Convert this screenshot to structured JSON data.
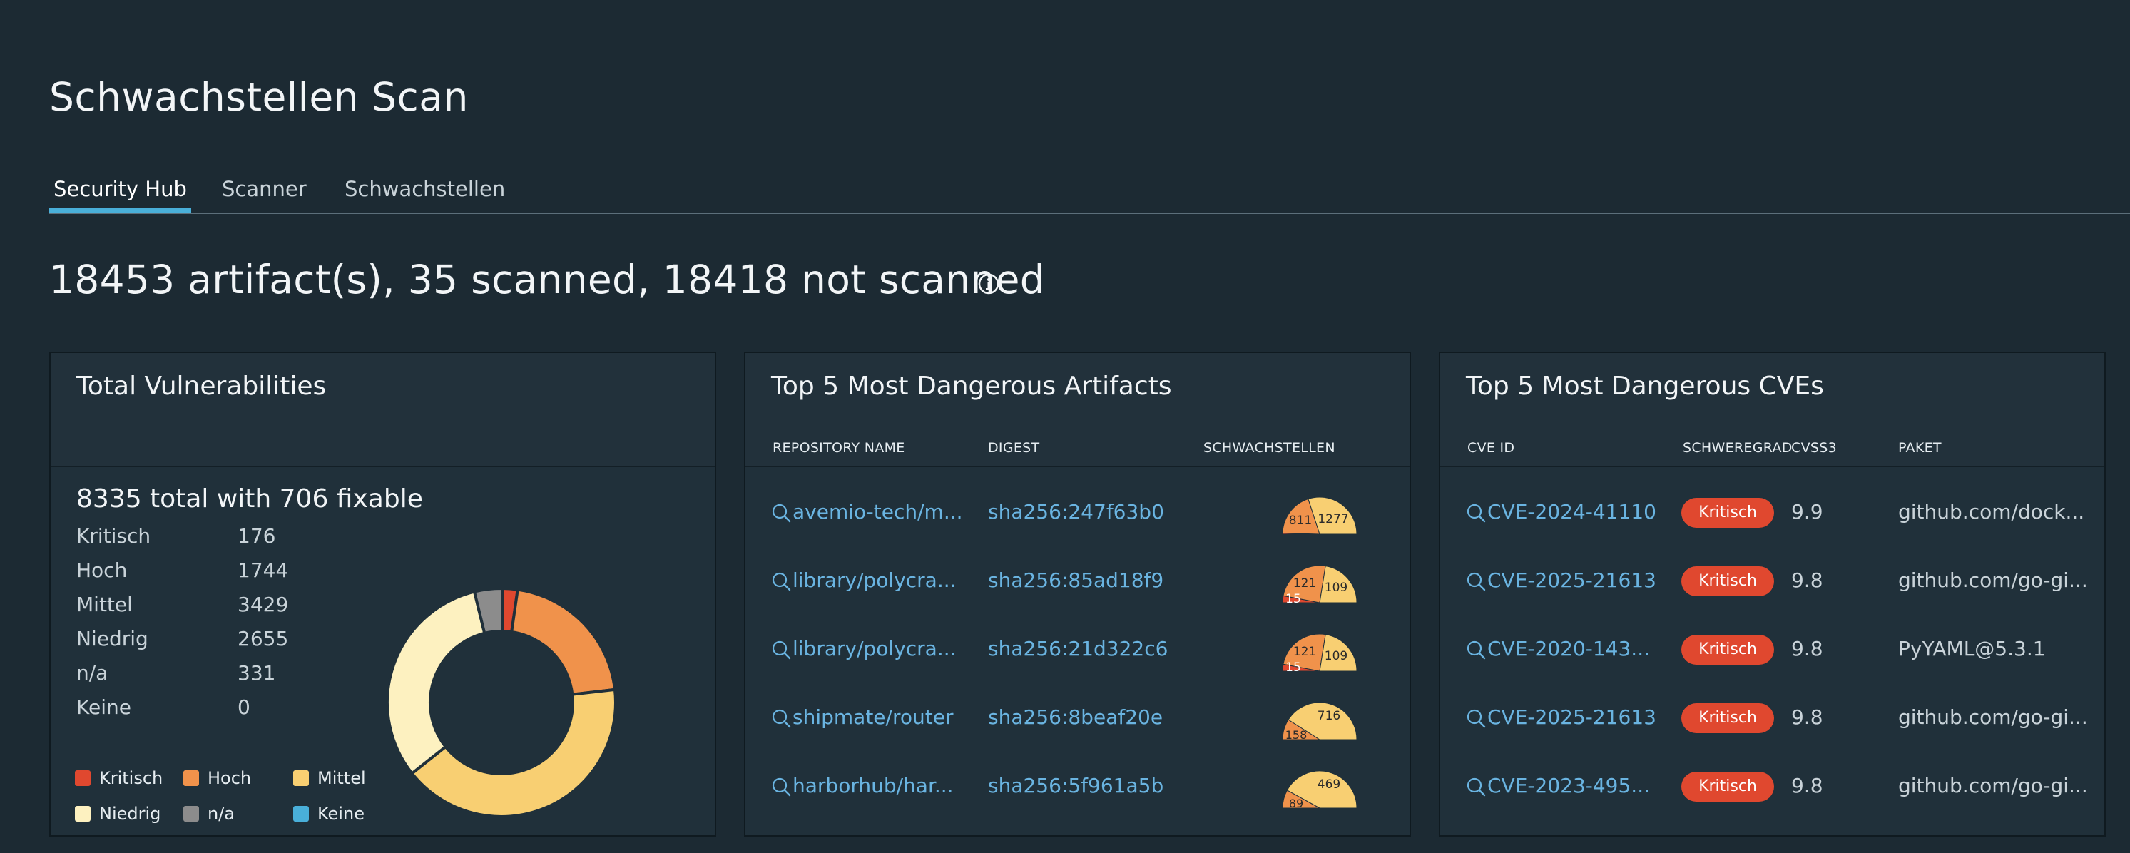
{
  "page": {
    "title": "Schwachstellen Scan"
  },
  "tabs": [
    {
      "label": "Security Hub",
      "active": true
    },
    {
      "label": "Scanner",
      "active": false
    },
    {
      "label": "Schwachstellen",
      "active": false
    }
  ],
  "summary": {
    "text": "18453 artifact(s), 35 scanned, 18418 not scanned",
    "icon": "info-icon"
  },
  "total_vulnerabilities": {
    "title": "Total Vulnerabilities",
    "headline": "8335 total with 706 fixable",
    "severities": [
      {
        "label": "Kritisch",
        "value": "176"
      },
      {
        "label": "Hoch",
        "value": "1744"
      },
      {
        "label": "Mittel",
        "value": "3429"
      },
      {
        "label": "Niedrig",
        "value": "2655"
      },
      {
        "label": "n/a",
        "value": "331"
      },
      {
        "label": "Keine",
        "value": "0"
      }
    ],
    "legend": [
      {
        "label": "Kritisch",
        "color": "#e0482f"
      },
      {
        "label": "Hoch",
        "color": "#f0924b"
      },
      {
        "label": "Mittel",
        "color": "#f8cf72"
      },
      {
        "label": "Niedrig",
        "color": "#fdf1c0"
      },
      {
        "label": "n/a",
        "color": "#8c8c8c"
      },
      {
        "label": "Keine",
        "color": "#49afd9"
      }
    ]
  },
  "chart_data": {
    "type": "pie",
    "categories": [
      "Kritisch",
      "Hoch",
      "Mittel",
      "Niedrig",
      "n/a",
      "Keine"
    ],
    "values": [
      176,
      1744,
      3429,
      2655,
      331,
      0
    ],
    "colors": [
      "#e0482f",
      "#f0924b",
      "#f8cf72",
      "#fdf1c0",
      "#8c8c8c",
      "#49afd9"
    ],
    "donut": true
  },
  "artifacts": {
    "title": "Top 5 Most Dangerous Artifacts",
    "columns": [
      "REPOSITORY NAME",
      "DIGEST",
      "SCHWACHSTELLEN"
    ],
    "rows": [
      {
        "repo": "avemio-tech/m...",
        "digest": "sha256:247f63b0",
        "counts": {
          "kritisch": "",
          "hoch": "811",
          "mittel": "1277"
        },
        "shares": [
          0.01,
          0.39,
          0.6
        ]
      },
      {
        "repo": "library/polycra...",
        "digest": "sha256:85ad18f9",
        "counts": {
          "kritisch": "15",
          "hoch": "121",
          "mittel": "109"
        },
        "shares": [
          0.06,
          0.49,
          0.45
        ]
      },
      {
        "repo": "library/polycra...",
        "digest": "sha256:21d322c6",
        "counts": {
          "kritisch": "15",
          "hoch": "121",
          "mittel": "109"
        },
        "shares": [
          0.06,
          0.49,
          0.45
        ]
      },
      {
        "repo": "shipmate/router",
        "digest": "sha256:8beaf20e",
        "counts": {
          "kritisch": "",
          "hoch": "158",
          "mittel": "716"
        },
        "shares": [
          0.0,
          0.18,
          0.82
        ]
      },
      {
        "repo": "harborhub/har...",
        "digest": "sha256:5f961a5b",
        "counts": {
          "kritisch": "",
          "hoch": "89",
          "mittel": "469"
        },
        "shares": [
          0.0,
          0.16,
          0.84
        ]
      }
    ]
  },
  "cves": {
    "title": "Top 5 Most Dangerous CVEs",
    "columns": [
      "CVE ID",
      "SCHWEREGRAD",
      "CVSS3",
      "PAKET"
    ],
    "rows": [
      {
        "id": "CVE-2024-41110",
        "severity": "Kritisch",
        "cvss": "9.9",
        "package": "github.com/dock..."
      },
      {
        "id": "CVE-2025-21613",
        "severity": "Kritisch",
        "cvss": "9.8",
        "package": "github.com/go-gi..."
      },
      {
        "id": "CVE-2020-143...",
        "severity": "Kritisch",
        "cvss": "9.8",
        "package": "PyYAML@5.3.1"
      },
      {
        "id": "CVE-2025-21613",
        "severity": "Kritisch",
        "cvss": "9.8",
        "package": "github.com/go-gi..."
      },
      {
        "id": "CVE-2023-495...",
        "severity": "Kritisch",
        "cvss": "9.8",
        "package": "github.com/go-gi..."
      }
    ]
  }
}
